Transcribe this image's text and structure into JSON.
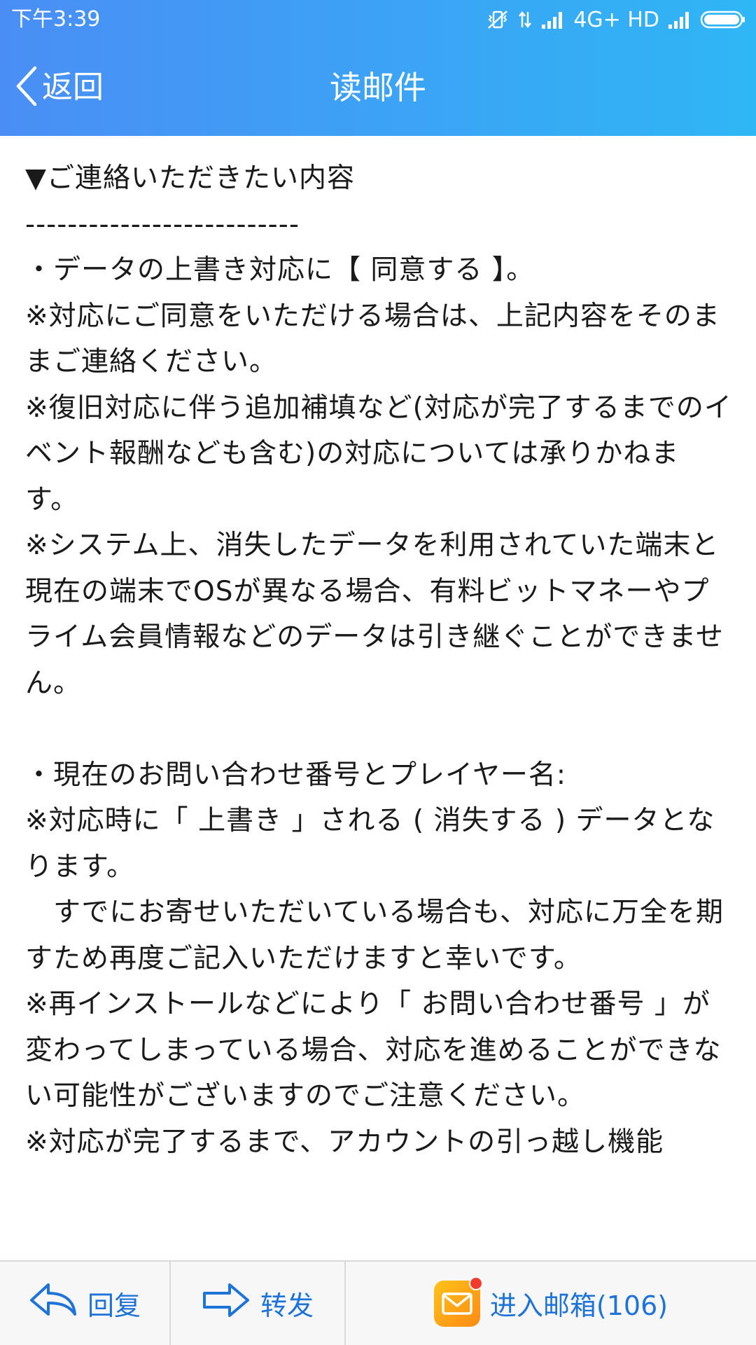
{
  "status_bar": {
    "time": "下午3:39",
    "network": "4G+ HD"
  },
  "nav": {
    "back_label": "返回",
    "title": "读邮件"
  },
  "mail": {
    "lines": [
      "▼ご連絡いただきたい内容",
      "--------------------------",
      "・データの上書き対応に【 同意する 】。",
      "※対応にご同意をいただける場合は、上記内容をそのままご連絡ください。",
      "※復旧対応に伴う追加補填など(対応が完了するまでのイベント報酬なども含む)の対応については承りかねます。",
      "※システム上、消失したデータを利用されていた端末と現在の端末でOSが異なる場合、有料ビットマネーやプライム会員情報などのデータは引き継ぐことができません。",
      "",
      "・現在のお問い合わせ番号とプレイヤー名:",
      "※対応時に「 上書き 」される ( 消失する ) データとなります。",
      "　すでにお寄せいただいている場合も、対応に万全を期すため再度ご記入いただけますと幸いです。",
      "※再インストールなどにより「 お問い合わせ番号 」が変わってしまっている場合、対応を進めることができない可能性がございますのでご注意ください。",
      "※対応が完了するまで、アカウントの引っ越し機能"
    ]
  },
  "bottom_bar": {
    "reply_label": "回复",
    "forward_label": "转发",
    "inbox_label": "进入邮箱(106)"
  },
  "colors": {
    "header_start": "#4a8ef5",
    "header_end": "#2fb6f5",
    "action_blue": "#1e73d8",
    "mailbox_icon": "#ffa81a",
    "badge": "#f23b2f"
  },
  "icons": {
    "back": "chevron-left-icon",
    "reply": "reply-arrow-icon",
    "forward": "forward-arrow-icon",
    "mailbox": "mail-envelope-icon"
  }
}
